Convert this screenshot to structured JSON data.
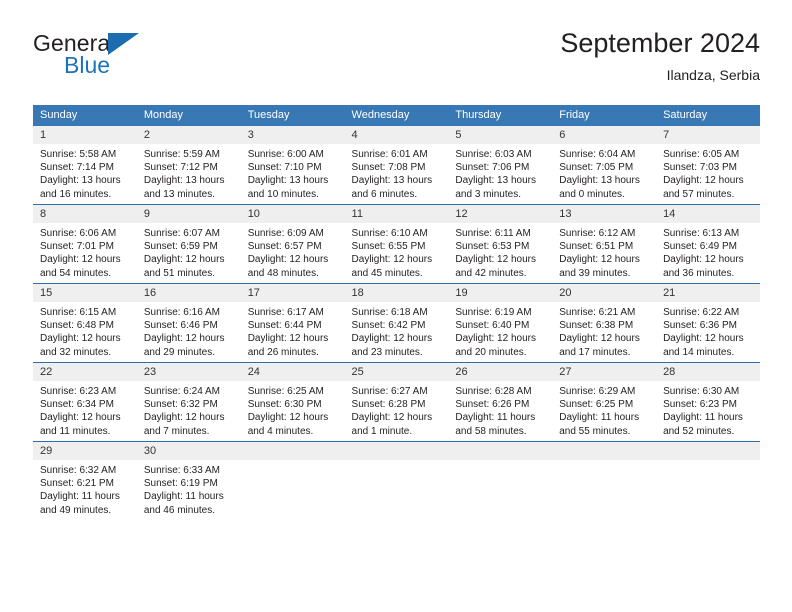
{
  "brand": {
    "name_part1": "General",
    "name_part2": "Blue",
    "accent_color": "#1b74bb"
  },
  "header": {
    "title": "September 2024",
    "subtitle": "Ilandza, Serbia"
  },
  "calendar": {
    "header_bg": "#3778b5",
    "row_divider_color": "#2f6ea8",
    "daynum_bg": "#efefef",
    "weekdays": [
      "Sunday",
      "Monday",
      "Tuesday",
      "Wednesday",
      "Thursday",
      "Friday",
      "Saturday"
    ],
    "weeks": [
      [
        {
          "day": "1",
          "sunrise": "Sunrise: 5:58 AM",
          "sunset": "Sunset: 7:14 PM",
          "daylight_line1": "Daylight: 13 hours",
          "daylight_line2": "and 16 minutes."
        },
        {
          "day": "2",
          "sunrise": "Sunrise: 5:59 AM",
          "sunset": "Sunset: 7:12 PM",
          "daylight_line1": "Daylight: 13 hours",
          "daylight_line2": "and 13 minutes."
        },
        {
          "day": "3",
          "sunrise": "Sunrise: 6:00 AM",
          "sunset": "Sunset: 7:10 PM",
          "daylight_line1": "Daylight: 13 hours",
          "daylight_line2": "and 10 minutes."
        },
        {
          "day": "4",
          "sunrise": "Sunrise: 6:01 AM",
          "sunset": "Sunset: 7:08 PM",
          "daylight_line1": "Daylight: 13 hours",
          "daylight_line2": "and 6 minutes."
        },
        {
          "day": "5",
          "sunrise": "Sunrise: 6:03 AM",
          "sunset": "Sunset: 7:06 PM",
          "daylight_line1": "Daylight: 13 hours",
          "daylight_line2": "and 3 minutes."
        },
        {
          "day": "6",
          "sunrise": "Sunrise: 6:04 AM",
          "sunset": "Sunset: 7:05 PM",
          "daylight_line1": "Daylight: 13 hours",
          "daylight_line2": "and 0 minutes."
        },
        {
          "day": "7",
          "sunrise": "Sunrise: 6:05 AM",
          "sunset": "Sunset: 7:03 PM",
          "daylight_line1": "Daylight: 12 hours",
          "daylight_line2": "and 57 minutes."
        }
      ],
      [
        {
          "day": "8",
          "sunrise": "Sunrise: 6:06 AM",
          "sunset": "Sunset: 7:01 PM",
          "daylight_line1": "Daylight: 12 hours",
          "daylight_line2": "and 54 minutes."
        },
        {
          "day": "9",
          "sunrise": "Sunrise: 6:07 AM",
          "sunset": "Sunset: 6:59 PM",
          "daylight_line1": "Daylight: 12 hours",
          "daylight_line2": "and 51 minutes."
        },
        {
          "day": "10",
          "sunrise": "Sunrise: 6:09 AM",
          "sunset": "Sunset: 6:57 PM",
          "daylight_line1": "Daylight: 12 hours",
          "daylight_line2": "and 48 minutes."
        },
        {
          "day": "11",
          "sunrise": "Sunrise: 6:10 AM",
          "sunset": "Sunset: 6:55 PM",
          "daylight_line1": "Daylight: 12 hours",
          "daylight_line2": "and 45 minutes."
        },
        {
          "day": "12",
          "sunrise": "Sunrise: 6:11 AM",
          "sunset": "Sunset: 6:53 PM",
          "daylight_line1": "Daylight: 12 hours",
          "daylight_line2": "and 42 minutes."
        },
        {
          "day": "13",
          "sunrise": "Sunrise: 6:12 AM",
          "sunset": "Sunset: 6:51 PM",
          "daylight_line1": "Daylight: 12 hours",
          "daylight_line2": "and 39 minutes."
        },
        {
          "day": "14",
          "sunrise": "Sunrise: 6:13 AM",
          "sunset": "Sunset: 6:49 PM",
          "daylight_line1": "Daylight: 12 hours",
          "daylight_line2": "and 36 minutes."
        }
      ],
      [
        {
          "day": "15",
          "sunrise": "Sunrise: 6:15 AM",
          "sunset": "Sunset: 6:48 PM",
          "daylight_line1": "Daylight: 12 hours",
          "daylight_line2": "and 32 minutes."
        },
        {
          "day": "16",
          "sunrise": "Sunrise: 6:16 AM",
          "sunset": "Sunset: 6:46 PM",
          "daylight_line1": "Daylight: 12 hours",
          "daylight_line2": "and 29 minutes."
        },
        {
          "day": "17",
          "sunrise": "Sunrise: 6:17 AM",
          "sunset": "Sunset: 6:44 PM",
          "daylight_line1": "Daylight: 12 hours",
          "daylight_line2": "and 26 minutes."
        },
        {
          "day": "18",
          "sunrise": "Sunrise: 6:18 AM",
          "sunset": "Sunset: 6:42 PM",
          "daylight_line1": "Daylight: 12 hours",
          "daylight_line2": "and 23 minutes."
        },
        {
          "day": "19",
          "sunrise": "Sunrise: 6:19 AM",
          "sunset": "Sunset: 6:40 PM",
          "daylight_line1": "Daylight: 12 hours",
          "daylight_line2": "and 20 minutes."
        },
        {
          "day": "20",
          "sunrise": "Sunrise: 6:21 AM",
          "sunset": "Sunset: 6:38 PM",
          "daylight_line1": "Daylight: 12 hours",
          "daylight_line2": "and 17 minutes."
        },
        {
          "day": "21",
          "sunrise": "Sunrise: 6:22 AM",
          "sunset": "Sunset: 6:36 PM",
          "daylight_line1": "Daylight: 12 hours",
          "daylight_line2": "and 14 minutes."
        }
      ],
      [
        {
          "day": "22",
          "sunrise": "Sunrise: 6:23 AM",
          "sunset": "Sunset: 6:34 PM",
          "daylight_line1": "Daylight: 12 hours",
          "daylight_line2": "and 11 minutes."
        },
        {
          "day": "23",
          "sunrise": "Sunrise: 6:24 AM",
          "sunset": "Sunset: 6:32 PM",
          "daylight_line1": "Daylight: 12 hours",
          "daylight_line2": "and 7 minutes."
        },
        {
          "day": "24",
          "sunrise": "Sunrise: 6:25 AM",
          "sunset": "Sunset: 6:30 PM",
          "daylight_line1": "Daylight: 12 hours",
          "daylight_line2": "and 4 minutes."
        },
        {
          "day": "25",
          "sunrise": "Sunrise: 6:27 AM",
          "sunset": "Sunset: 6:28 PM",
          "daylight_line1": "Daylight: 12 hours",
          "daylight_line2": "and 1 minute."
        },
        {
          "day": "26",
          "sunrise": "Sunrise: 6:28 AM",
          "sunset": "Sunset: 6:26 PM",
          "daylight_line1": "Daylight: 11 hours",
          "daylight_line2": "and 58 minutes."
        },
        {
          "day": "27",
          "sunrise": "Sunrise: 6:29 AM",
          "sunset": "Sunset: 6:25 PM",
          "daylight_line1": "Daylight: 11 hours",
          "daylight_line2": "and 55 minutes."
        },
        {
          "day": "28",
          "sunrise": "Sunrise: 6:30 AM",
          "sunset": "Sunset: 6:23 PM",
          "daylight_line1": "Daylight: 11 hours",
          "daylight_line2": "and 52 minutes."
        }
      ],
      [
        {
          "day": "29",
          "sunrise": "Sunrise: 6:32 AM",
          "sunset": "Sunset: 6:21 PM",
          "daylight_line1": "Daylight: 11 hours",
          "daylight_line2": "and 49 minutes."
        },
        {
          "day": "30",
          "sunrise": "Sunrise: 6:33 AM",
          "sunset": "Sunset: 6:19 PM",
          "daylight_line1": "Daylight: 11 hours",
          "daylight_line2": "and 46 minutes."
        },
        {
          "day": "",
          "sunrise": "",
          "sunset": "",
          "daylight_line1": "",
          "daylight_line2": ""
        },
        {
          "day": "",
          "sunrise": "",
          "sunset": "",
          "daylight_line1": "",
          "daylight_line2": ""
        },
        {
          "day": "",
          "sunrise": "",
          "sunset": "",
          "daylight_line1": "",
          "daylight_line2": ""
        },
        {
          "day": "",
          "sunrise": "",
          "sunset": "",
          "daylight_line1": "",
          "daylight_line2": ""
        },
        {
          "day": "",
          "sunrise": "",
          "sunset": "",
          "daylight_line1": "",
          "daylight_line2": ""
        }
      ]
    ]
  }
}
